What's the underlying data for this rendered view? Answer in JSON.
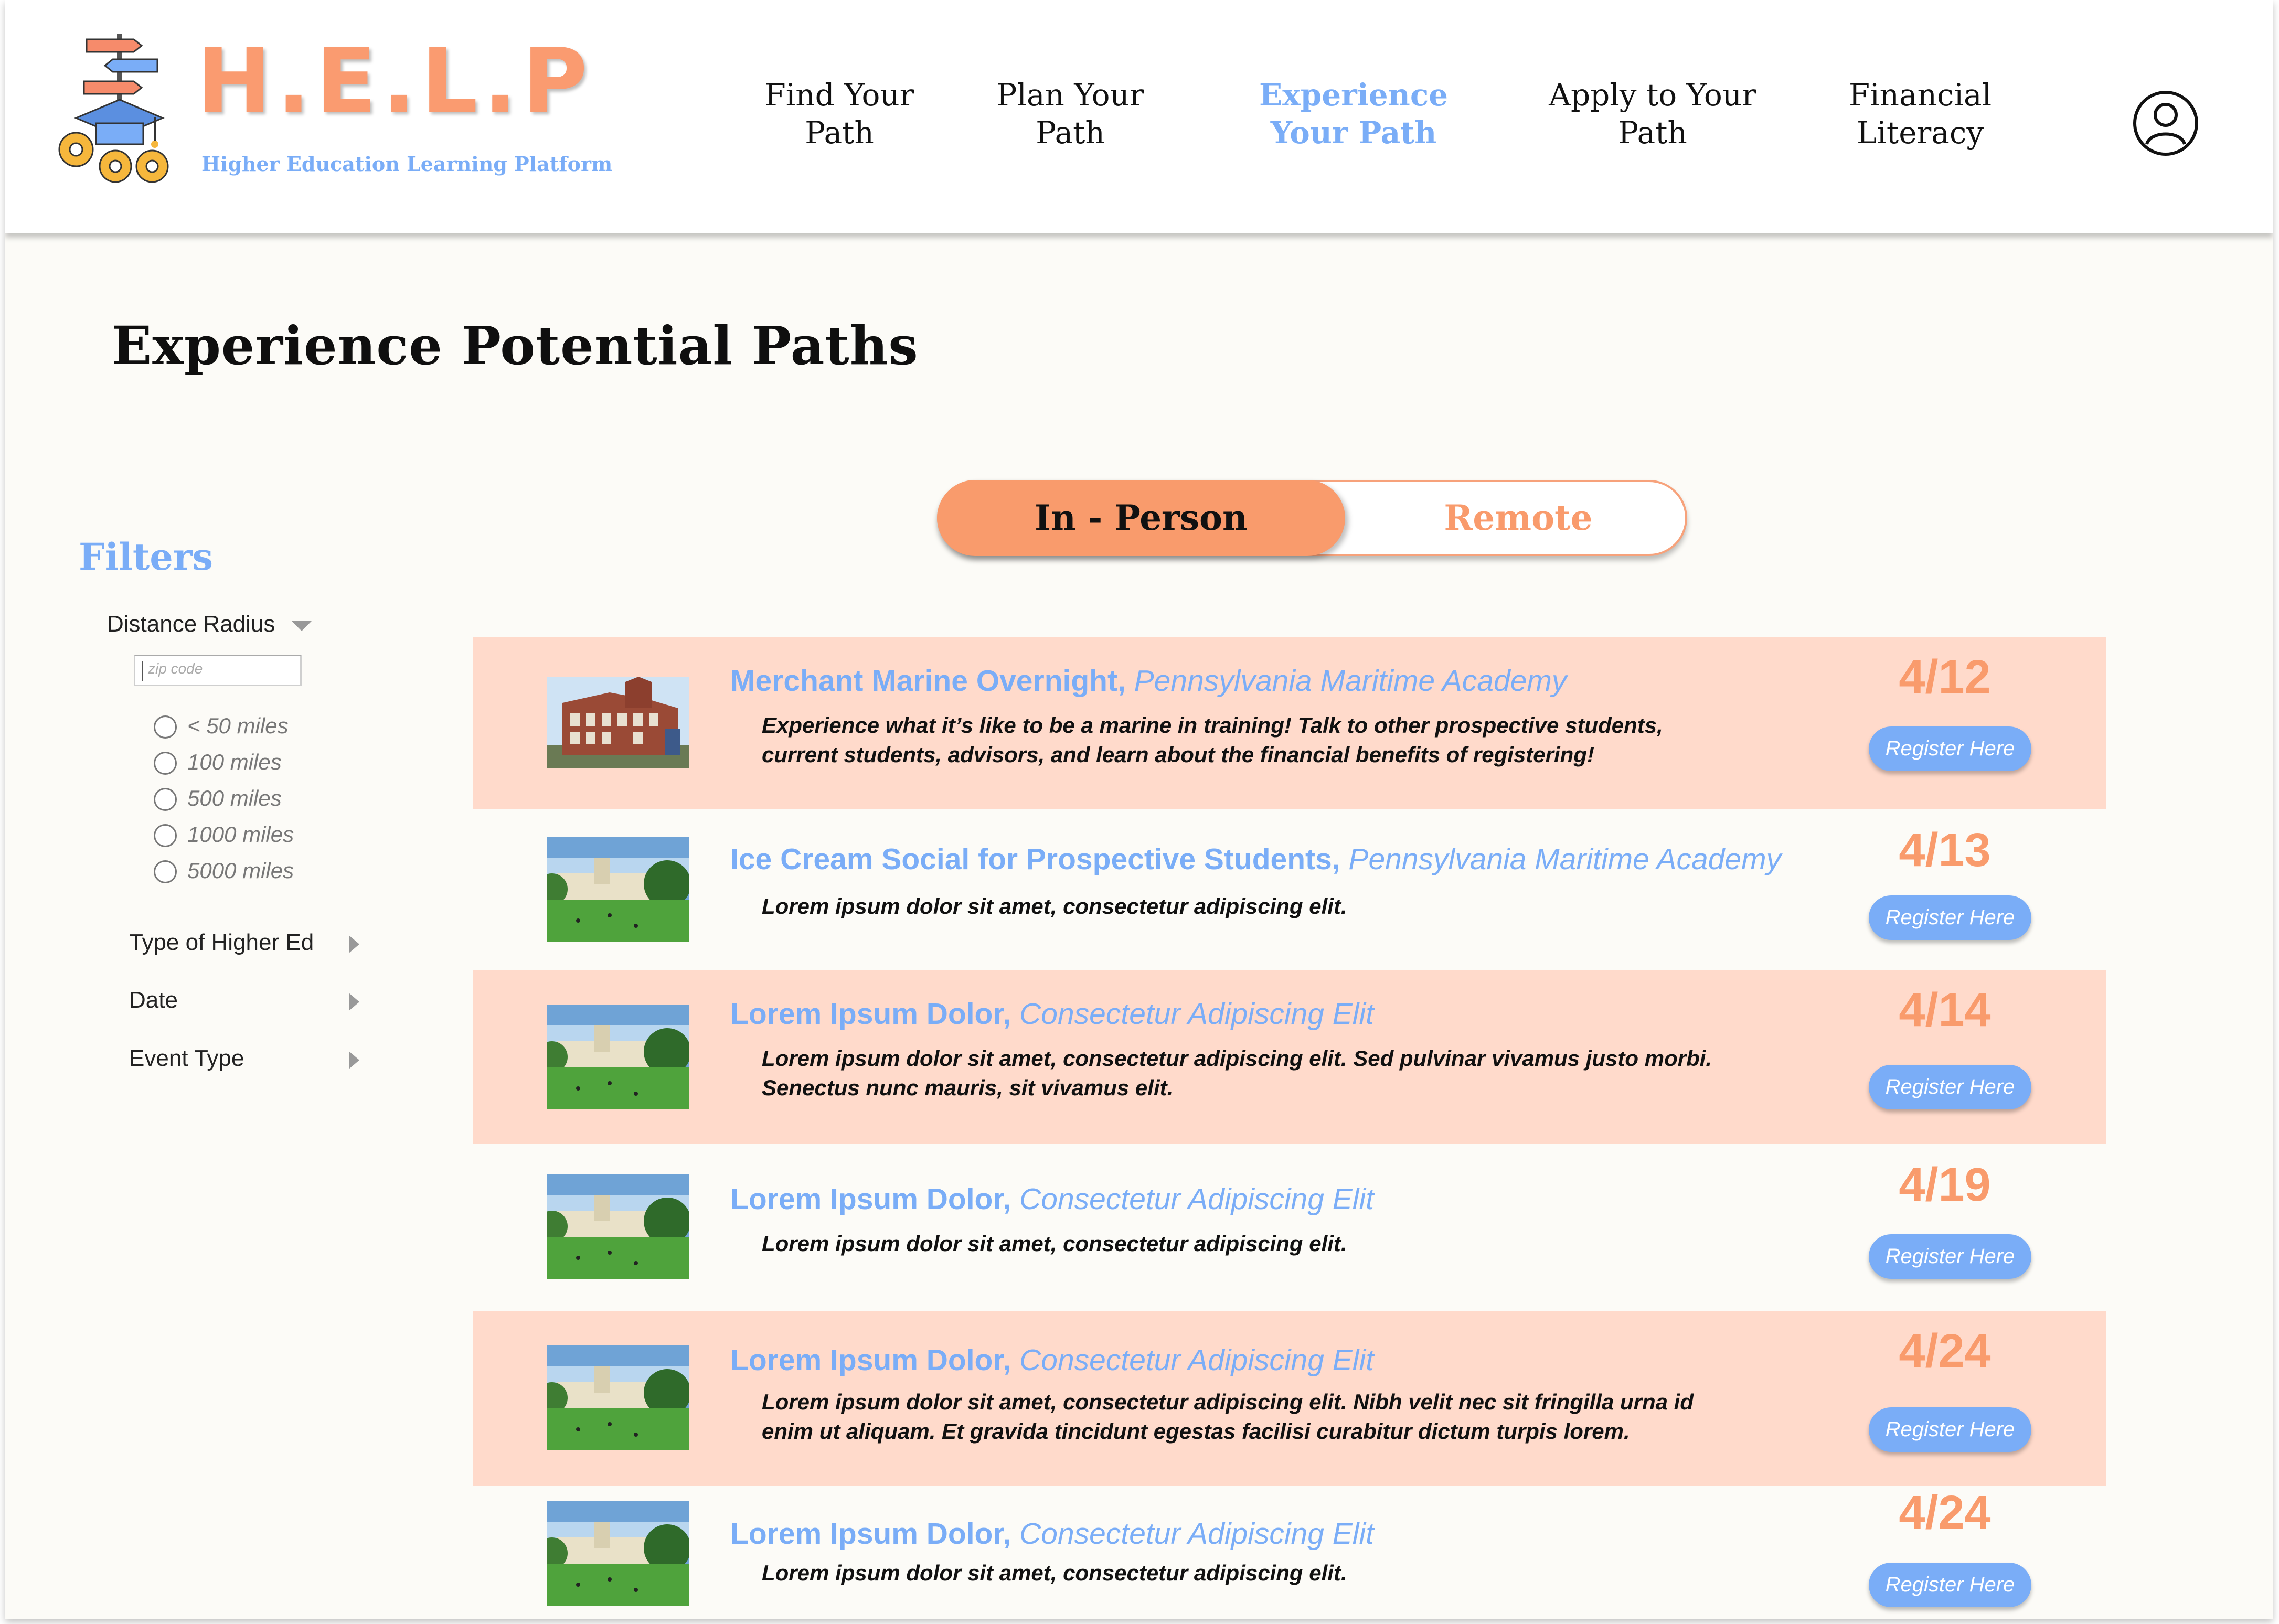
{
  "header": {
    "logo_text": "H.E.L.P",
    "logo_subtitle": "Higher Education Learning Platform",
    "logo_icon": "signpost-graduation-cap-gears-icon",
    "nav": [
      {
        "line1": "Find Your",
        "line2": "Path",
        "active": false
      },
      {
        "line1": "Plan Your",
        "line2": "Path",
        "active": false
      },
      {
        "line1": "Experience",
        "line2": "Your Path",
        "active": true
      },
      {
        "line1": "Apply to Your",
        "line2": "Path",
        "active": false
      },
      {
        "line1": "Financial",
        "line2": "Literacy",
        "active": false
      }
    ],
    "account_icon": "user-account-icon"
  },
  "page_title": "Experience Potential Paths",
  "toggle": {
    "selected": "In - Person",
    "other": "Remote"
  },
  "filters": {
    "title": "Filters",
    "distance_label": "Distance Radius",
    "zip_placeholder": "zip code",
    "radius_options": [
      "< 50 miles",
      "100 miles",
      "500 miles",
      "1000 miles",
      "5000 miles"
    ],
    "sections": [
      "Type of Higher Ed",
      "Date",
      "Event Type"
    ]
  },
  "events": [
    {
      "name": "Merchant Marine Overnight,",
      "host": "Pennsylvania Maritime Academy",
      "description": "Experience what it’s like to be a marine in training! Talk to other prospective students, current students, advisors, and learn about the financial benefits of registering!",
      "date": "4/12",
      "button": "Register Here",
      "image": "brick-building-photo"
    },
    {
      "name": "Ice Cream Social for Prospective Students,",
      "host": "Pennsylvania Maritime Academy",
      "description": "Lorem ipsum dolor sit amet, consectetur adipiscing elit.",
      "date": "4/13",
      "button": "Register Here",
      "image": "campus-lawn-photo"
    },
    {
      "name": "Lorem Ipsum Dolor,",
      "host": "Consectetur Adipiscing Elit",
      "description": "Lorem ipsum dolor sit amet, consectetur adipiscing elit. Sed pulvinar vivamus justo morbi. Senectus nunc mauris, sit vivamus elit.",
      "date": "4/14",
      "button": "Register Here",
      "image": "campus-lawn-photo"
    },
    {
      "name": "Lorem Ipsum Dolor,",
      "host": "Consectetur Adipiscing Elit",
      "description": "Lorem ipsum dolor sit amet, consectetur adipiscing elit.",
      "date": "4/19",
      "button": "Register Here",
      "image": "campus-lawn-photo"
    },
    {
      "name": "Lorem Ipsum Dolor,",
      "host": "Consectetur Adipiscing Elit",
      "description": "Lorem ipsum dolor sit amet, consectetur adipiscing elit. Nibh velit nec sit fringilla urna id enim ut aliquam. Et gravida tincidunt egestas facilisi curabitur dictum turpis lorem.",
      "date": "4/24",
      "button": "Register Here",
      "image": "campus-lawn-photo"
    },
    {
      "name": "Lorem Ipsum Dolor,",
      "host": "Consectetur Adipiscing Elit",
      "description": "Lorem ipsum dolor sit amet, consectetur adipiscing elit.",
      "date": "4/24",
      "button": "Register Here",
      "image": "campus-lawn-photo"
    }
  ],
  "colors": {
    "accent_orange": "#f99b6c",
    "accent_blue": "#7aadf7",
    "row_shade": "#ffdacb",
    "page_bg": "#fcfbf7"
  }
}
